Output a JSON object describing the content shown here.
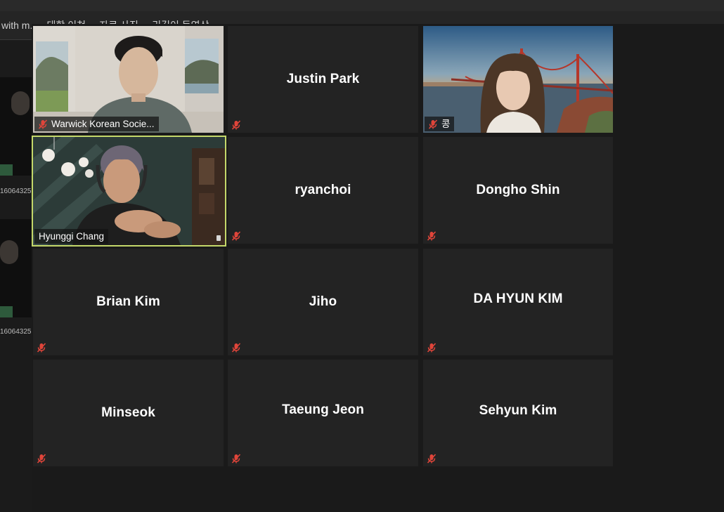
{
  "background": {
    "title": "with m... · 대학 이천 ... 자료 사진 ... 리길이 동영상",
    "sidebar_ids": [
      "16064325",
      "16064325"
    ]
  },
  "participants": [
    {
      "name": "Warwick Korean Socie...",
      "video": true,
      "muted": true
    },
    {
      "name": "Justin Park",
      "video": false,
      "muted": true
    },
    {
      "name": "콩",
      "video": true,
      "muted": true
    },
    {
      "name": "Hyunggi Chang",
      "video": true,
      "muted": false,
      "active_speaker": true
    },
    {
      "name": "ryanchoi",
      "video": false,
      "muted": true
    },
    {
      "name": "Dongho Shin",
      "video": false,
      "muted": true
    },
    {
      "name": "Brian Kim",
      "video": false,
      "muted": true
    },
    {
      "name": "Jiho",
      "video": false,
      "muted": true
    },
    {
      "name": "DA HYUN KIM",
      "video": false,
      "muted": true
    },
    {
      "name": "Minseok",
      "video": false,
      "muted": true
    },
    {
      "name": "Taeung Jeon",
      "video": false,
      "muted": true
    },
    {
      "name": "Sehyun Kim",
      "video": false,
      "muted": true
    }
  ],
  "icons": {
    "mute": "mic-muted-icon"
  },
  "colors": {
    "active_border": "#c4d86a",
    "mute_icon": "#e0453a",
    "tile_bg": "#232323"
  }
}
